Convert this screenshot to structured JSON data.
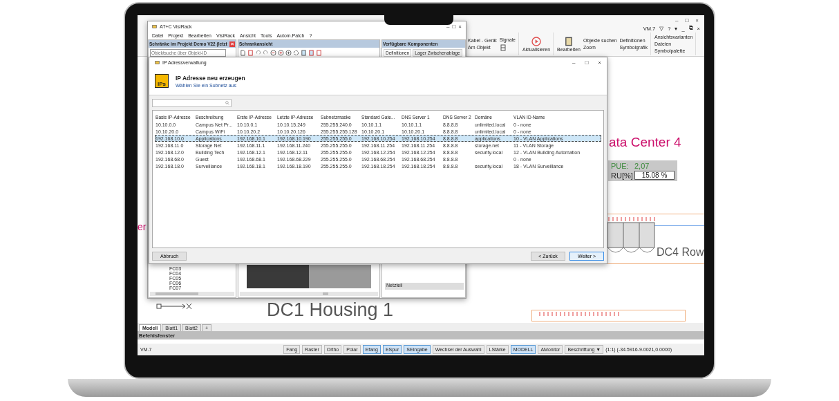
{
  "cad": {
    "title_bar": {
      "controls": [
        "–",
        "□",
        "×"
      ]
    },
    "user_bar": {
      "user": "VM.7",
      "items": [
        "▽",
        "?",
        "▾",
        "_",
        "⧉",
        "×"
      ]
    },
    "ribbon": {
      "cable": {
        "label": "Kabel - Gerät"
      },
      "signals": {
        "label": "Signale"
      },
      "on_object": {
        "label": "Am Objekt"
      },
      "refresh": {
        "label": "Aktualisieren"
      },
      "edit": {
        "label": "Bearbeiten"
      },
      "find": {
        "label": "Objekte suchen"
      },
      "zoom": {
        "label": "Zoom"
      },
      "definitions": {
        "label": "Definitionen"
      },
      "symbol_graphic": {
        "label": "Symbolgrafik"
      },
      "view_variants": {
        "label": "Ansichtsvarianten"
      },
      "files": {
        "label": "Dateien"
      },
      "symbol_palette": {
        "label": "Symbolpalette"
      }
    },
    "canvas": {
      "fragment": "er",
      "title": "ata Center 4",
      "pue_label": "PUE:",
      "pue_value": "2,07",
      "ru_label": "RU[%]",
      "ru_value": "15.08 %",
      "row_label": "DC4 Row",
      "housing_label": "DC1 Housing 1"
    },
    "sheet_tabs": [
      {
        "label": "Modell",
        "selected": true
      },
      {
        "label": "Blatt1",
        "selected": false
      },
      {
        "label": "Blatt2",
        "selected": false
      },
      {
        "label": "+",
        "selected": false
      }
    ],
    "command_window": {
      "title": "Befehlsfenster"
    },
    "status_bar": {
      "user": "VM.7",
      "toggles": [
        {
          "label": "Fang",
          "on": false
        },
        {
          "label": "Raster",
          "on": false
        },
        {
          "label": "Ortho",
          "on": false
        },
        {
          "label": "Polar",
          "on": false
        },
        {
          "label": "Efang",
          "on": true
        },
        {
          "label": "ESpur",
          "on": true
        },
        {
          "label": "SEingabe",
          "on": true
        },
        {
          "label": "Wechsel der Auswahl",
          "on": false
        },
        {
          "label": "LStärke",
          "on": false
        },
        {
          "label": "MODELL",
          "on": true
        },
        {
          "label": "AMonitor",
          "on": false
        }
      ],
      "annotation": {
        "label": "Beschriftung",
        "caret": "▼"
      },
      "coordinates": "(1:1) (-34.5916-9.0021,0.0000)"
    }
  },
  "visirack": {
    "title": "AT+C VisiRack",
    "controls": [
      "–",
      "□",
      "×"
    ],
    "menu": [
      "Datei",
      "Projekt",
      "Bearbeiten",
      "VisiRack",
      "Ansicht",
      "Tools",
      "Autom.Patch",
      "?"
    ],
    "panels": [
      {
        "title": "Schränke im Projekt Demo V22 (letzt",
        "close": "×"
      },
      {
        "title": "Schrankansicht"
      },
      {
        "title": "Verfügbare Komponenten"
      }
    ],
    "search": {
      "placeholder": "Objektsuche über Objekt-ID"
    },
    "component_tabs": [
      {
        "label": "Definitionen",
        "selected": true
      },
      {
        "label": "Lager Zwischenablage",
        "selected": false
      }
    ],
    "tree_items": [
      "FC03",
      "FC04",
      "FC05",
      "FC06",
      "FC07"
    ],
    "power_supply_button": "Netzteil"
  },
  "dialog": {
    "title": "IP Adressverwaltung",
    "controls": [
      "–",
      "□",
      "×"
    ],
    "heading": "IP Adresse neu erzeugen",
    "subheading": "Wählen Sie ein Subnetz aus",
    "logo": "IPs",
    "table": {
      "columns": [
        "Basis IP-Adresse",
        "Beschreibung",
        "Erste IP-Adresse",
        "Letzte IP-Adresse",
        "Subnetzmaske",
        "Standard Gate...",
        "DNS Server 1",
        "DNS Server 2",
        "Domäne",
        "VLAN ID-Name"
      ],
      "rows": [
        {
          "selected": false,
          "cells": [
            "10.10.0.0",
            "Campus Net Pr...",
            "10.10.0.1",
            "10.10.15.249",
            "255.255.240.0",
            "10.10.1.1",
            "10.10.1.1",
            "8.8.8.8",
            "unlimited.local",
            "0 - none"
          ]
        },
        {
          "selected": false,
          "cells": [
            "10.10.20.0",
            "Campus WiFi",
            "10.10.20.2",
            "10.10.20.126",
            "255.255.255.128",
            "10.10.20.1",
            "10.10.20.1",
            "8.8.8.8",
            "unlimited.local",
            "0 - none"
          ]
        },
        {
          "selected": true,
          "cells": [
            "192.168.10.0",
            "Applications",
            "192.168.10.1",
            "192.168.10.190",
            "255.255.255.0",
            "192.168.10.254",
            "192.168.10.254",
            "8.8.8.8",
            "applications",
            "10 - VLAN Applications"
          ]
        },
        {
          "selected": false,
          "cells": [
            "192.168.11.0",
            "Storage Net",
            "192.168.11.1",
            "192.168.11.240",
            "255.255.255.0",
            "192.168.11.254",
            "192.168.11.254",
            "8.8.8.8",
            "storage.net",
            "11 - VLAN Storage"
          ]
        },
        {
          "selected": false,
          "cells": [
            "192.168.12.0",
            "Building Tech",
            "192.168.12.1",
            "192.168.12.11",
            "255.255.255.0",
            "192.168.12.254",
            "192.168.12.254",
            "8.8.8.8",
            "security.local",
            "12 - VLAN Building Automation"
          ]
        },
        {
          "selected": false,
          "cells": [
            "192.168.68.0",
            "Guest",
            "192.168.68.1",
            "192.168.68.229",
            "255.255.255.0",
            "192.168.68.254",
            "192.168.68.254",
            "8.8.8.8",
            "",
            "0 - none"
          ]
        },
        {
          "selected": false,
          "cells": [
            "192.168.18.0",
            "Surveillance",
            "192.168.18.1",
            "192.168.18.190",
            "255.255.255.0",
            "192.168.18.254",
            "192.168.18.254",
            "8.8.8.8",
            "security.local",
            "18 - VLAN Surveillance"
          ]
        }
      ]
    },
    "buttons": {
      "cancel": "Abbruch",
      "back": "< Zurück",
      "next": "Weiter >"
    }
  }
}
